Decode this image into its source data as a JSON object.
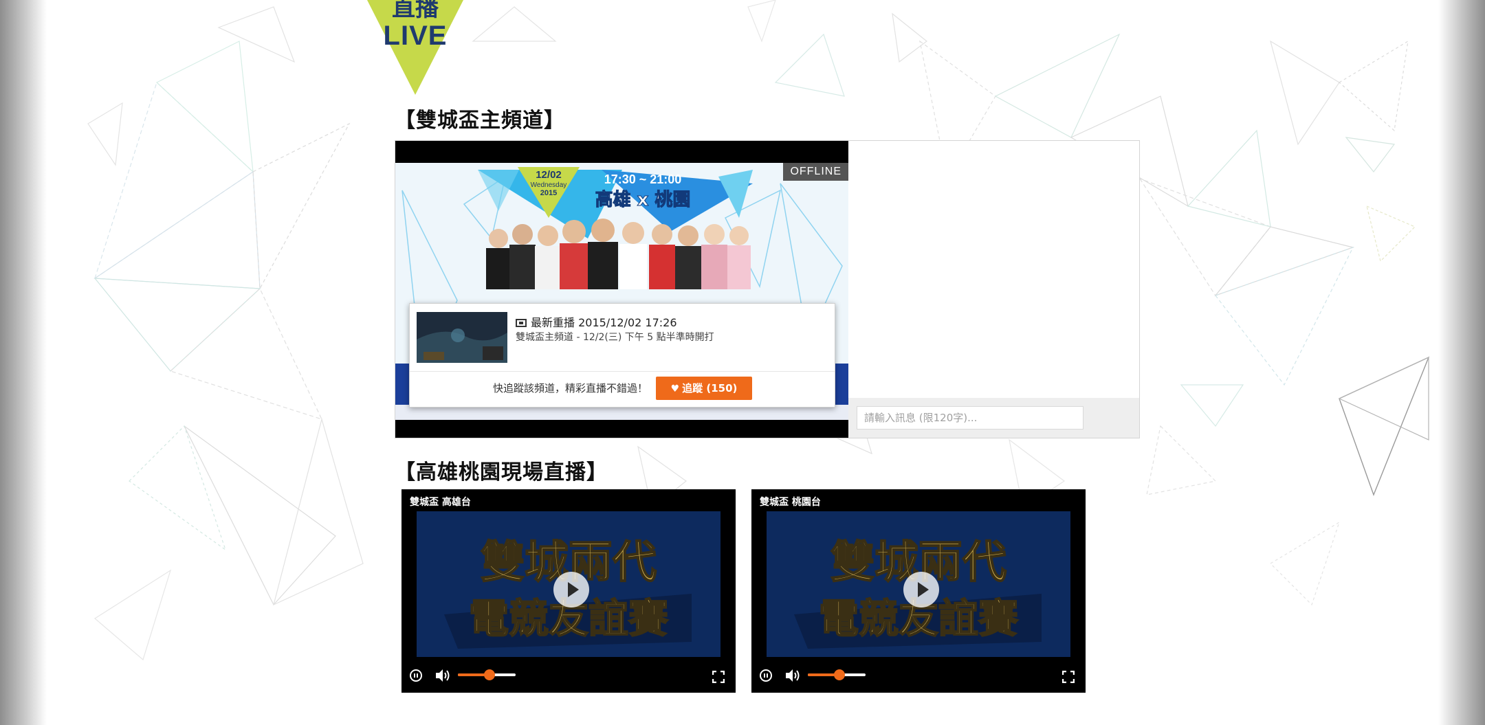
{
  "live_badge": {
    "top_text": "直播",
    "text": "LIVE"
  },
  "main_section": {
    "title": "【雙城盃主頻道】",
    "player": {
      "status_tag": "OFFLINE",
      "banner": {
        "date": "12/02",
        "weekday": "Wednesday",
        "year": "2015",
        "time": "17:30 ~ 21:00",
        "headline": "高雄 x 桃園"
      },
      "popup": {
        "rerun_label": "最新重播 2015/12/02 17:26",
        "rerun_desc": "雙城盃主頻道 - 12/2(三) 下午 5 點半準時開打",
        "follow_prompt": "快追蹤該頻道，精彩直播不錯過！",
        "follow_button": "追蹤 (150)"
      }
    },
    "chat": {
      "input_placeholder": "請輸入訊息 (限120字)..."
    }
  },
  "venue_section": {
    "title": "【高雄桃園現場直播】",
    "players": [
      {
        "label": "雙城盃 高雄台",
        "poster_line1": "雙城兩代",
        "poster_line2": "電競友誼賽",
        "volume": 0.55
      },
      {
        "label": "雙城盃 桃園台",
        "poster_line1": "雙城兩代",
        "poster_line2": "電競友誼賽",
        "volume": 0.55
      }
    ]
  },
  "colors": {
    "accent_orange": "#ef6a1a",
    "badge_lime": "#c6d94a",
    "badge_navy": "#1f3a6e",
    "poster_navy": "#0d2a5e"
  }
}
